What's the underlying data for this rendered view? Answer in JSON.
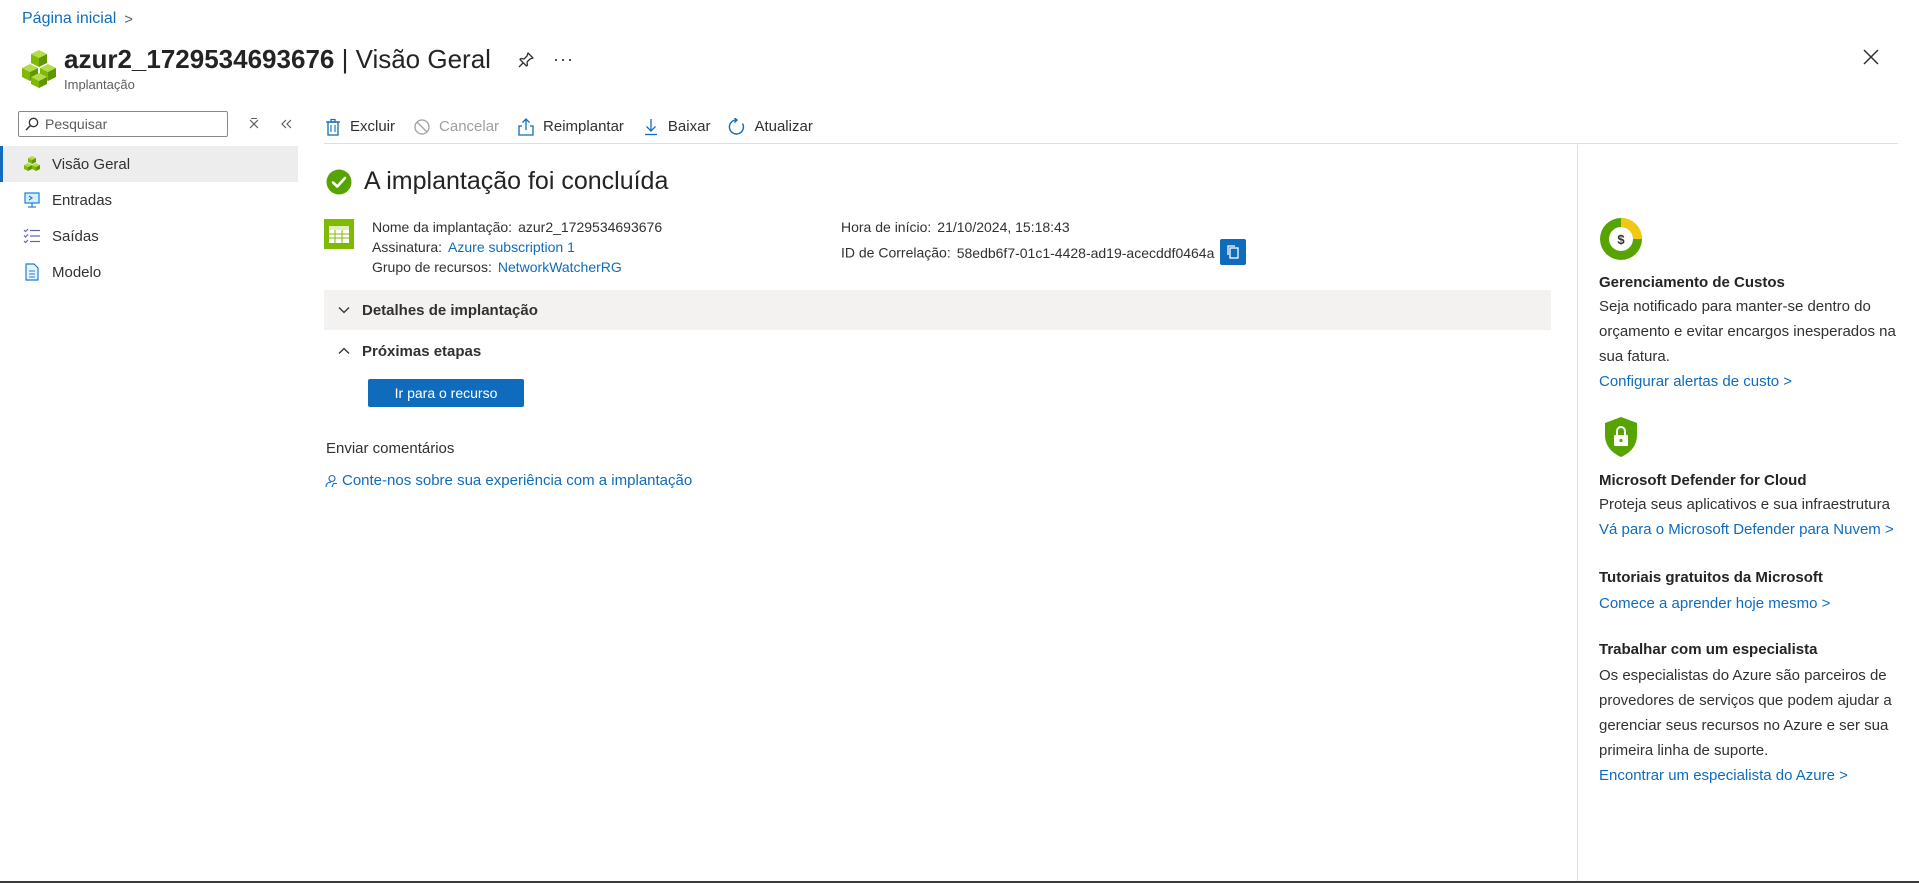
{
  "breadcrumb": {
    "home": "Página inicial",
    "sep": ">"
  },
  "header": {
    "resource_name": "azur2_1729534693676",
    "page_name": "| Visão Geral",
    "subtitle": "Implantação",
    "more": "···"
  },
  "sidebar": {
    "search_placeholder": "Pesquisar",
    "items": [
      {
        "label": "Visão Geral",
        "icon": "deployment-icon",
        "active": true
      },
      {
        "label": "Entradas",
        "icon": "inputs-icon"
      },
      {
        "label": "Saídas",
        "icon": "outputs-icon"
      },
      {
        "label": "Modelo",
        "icon": "template-icon"
      }
    ]
  },
  "toolbar": {
    "delete": "Excluir",
    "cancel": "Cancelar",
    "redeploy": "Reimplantar",
    "download": "Baixar",
    "refresh": "Atualizar"
  },
  "main": {
    "status_title": "A implantação foi concluída",
    "details": {
      "deployment_name_label": "Nome da implantação:",
      "deployment_name": "azur2_1729534693676",
      "subscription_label": "Assinatura:",
      "subscription": "Azure subscription 1",
      "resource_group_label": "Grupo de recursos:",
      "resource_group": "NetworkWatcherRG",
      "start_time_label": "Hora de início:",
      "start_time": "21/10/2024, 15:18:43",
      "correlation_label": "ID de Correlação:",
      "correlation_id": "58edb6f7-01c1-4428-ad19-acecddf0464a"
    },
    "deployment_details": "Detalhes de implantação",
    "next_steps": "Próximas etapas",
    "go_to_resource": "Ir para o recurso",
    "feedback_title": "Enviar comentários",
    "feedback_link": "Conte-nos sobre sua experiência com a implantação"
  },
  "right_panel": {
    "cost": {
      "title": "Gerenciamento de Custos",
      "desc": "Seja notificado para manter-se dentro do orçamento e evitar encargos inesperados na sua fatura.",
      "link": "Configurar alertas de custo >",
      "icon_glyph": "$"
    },
    "defender": {
      "title": "Microsoft Defender for Cloud",
      "desc": "Proteja seus aplicativos e sua infraestrutura",
      "link": "Vá para o Microsoft Defender para Nuvem >"
    },
    "tutorials": {
      "title": "Tutoriais gratuitos da Microsoft",
      "link": "Comece a aprender hoje mesmo >"
    },
    "expert": {
      "title": "Trabalhar com um especialista",
      "desc": "Os especialistas do Azure são parceiros de provedores de serviços que podem ajudar a gerenciar seus recursos no Azure e ser sua primeira linha de suporte.",
      "link": "Encontrar um especialista do Azure >"
    }
  },
  "colors": {
    "accent": "#0f6cbd",
    "success": "#57a300",
    "resource_green": "#7fba00"
  }
}
